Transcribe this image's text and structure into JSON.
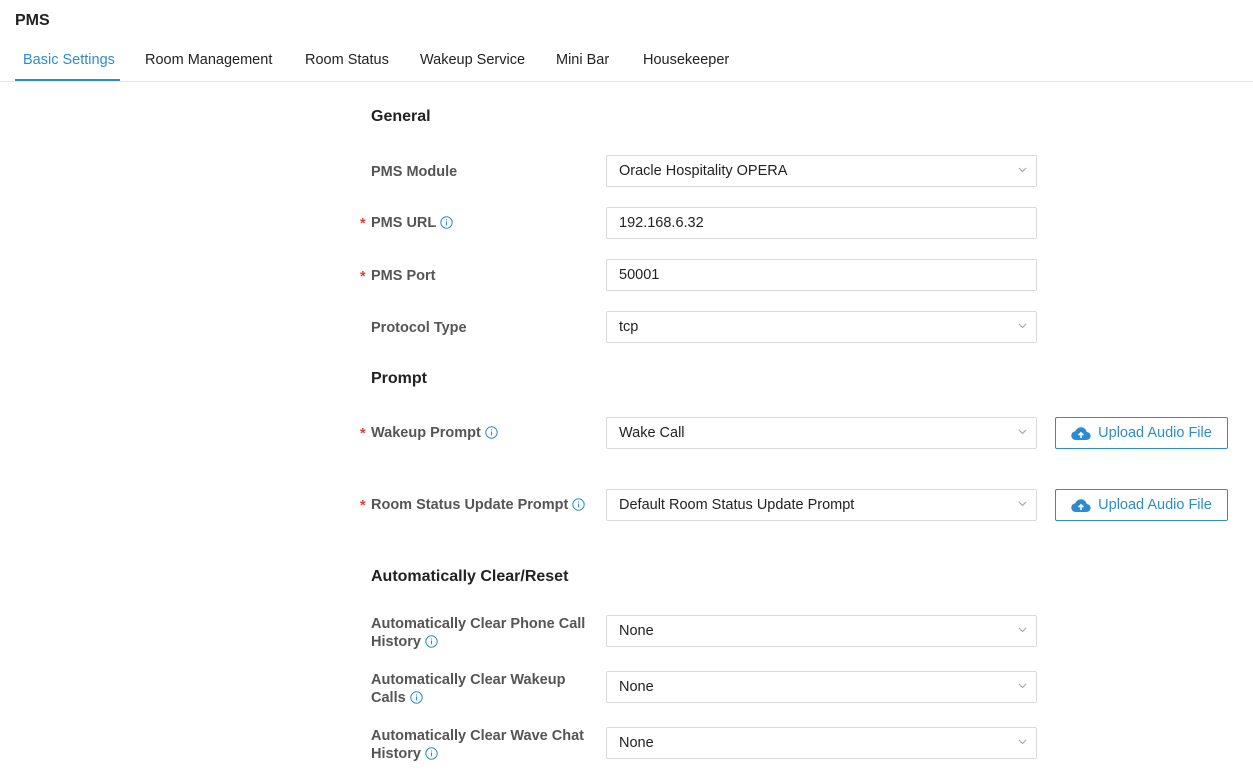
{
  "app": {
    "title": "PMS"
  },
  "tabs": [
    {
      "label": "Basic Settings"
    },
    {
      "label": "Room Management"
    },
    {
      "label": "Room Status"
    },
    {
      "label": "Wakeup Service"
    },
    {
      "label": "Mini Bar"
    },
    {
      "label": "Housekeeper"
    }
  ],
  "active_tab": "Basic Settings",
  "general": {
    "title": "General",
    "pms_module": {
      "label": "PMS Module",
      "value": "Oracle Hospitality OPERA"
    },
    "pms_url": {
      "label": "PMS URL",
      "value": "192.168.6.32",
      "required": true
    },
    "pms_port": {
      "label": "PMS Port",
      "value": "50001",
      "required": true
    },
    "protocol_type": {
      "label": "Protocol Type",
      "value": "tcp"
    }
  },
  "prompt": {
    "title": "Prompt",
    "wakeup_prompt": {
      "label": "Wakeup Prompt",
      "value": "Wake Call",
      "required": true
    },
    "room_status_prompt": {
      "label": "Room Status Update Prompt",
      "value": "Default Room Status Update Prompt",
      "required": true
    },
    "upload_label": "Upload Audio File"
  },
  "auto_clear": {
    "title": "Automatically Clear/Reset",
    "phone_call_history": {
      "label_line1": "Automatically Clear Phone Call",
      "label_line2": "History",
      "value": "None"
    },
    "wakeup_calls": {
      "label_line1": "Automatically Clear Wakeup",
      "label_line2": "Calls",
      "value": "None"
    },
    "wave_chat_history": {
      "label_line1": "Automatically Clear Wave Chat",
      "label_line2": "History",
      "value": "None"
    }
  },
  "colors": {
    "accent": "#2d8cd0",
    "required": "#e53935",
    "border": "#d9d9d9"
  }
}
